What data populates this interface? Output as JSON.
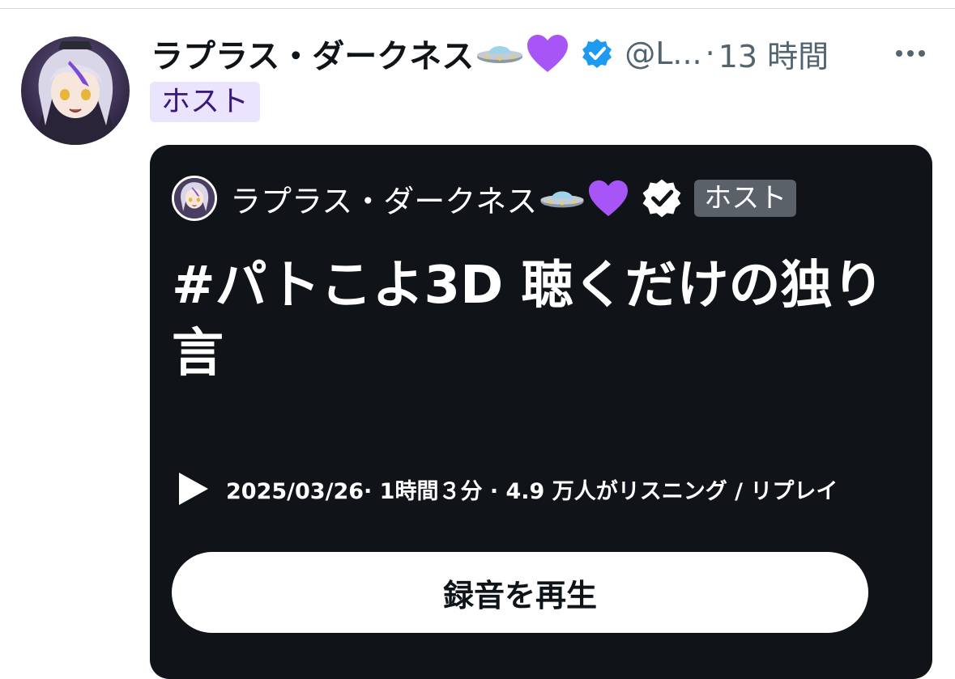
{
  "post": {
    "author_display_name": "ラプラス・ダークネス",
    "handle": "@L...",
    "separator": "·",
    "time_ago": "13 時間",
    "role_badge": "ホスト",
    "icons": {
      "avatar": "avatar-image",
      "ufo": "ufo-emoji-icon",
      "heart": "purple-heart-emoji-icon",
      "verified": "verified-badge-icon",
      "more": "more-options-icon"
    },
    "colors": {
      "verified_blue": "#1d9bf0",
      "badge_bg": "#ebe4ff",
      "card_bg": "#101418"
    }
  },
  "space_card": {
    "host_name": "ラプラス・ダークネス",
    "host_badge": "ホスト",
    "title": "#パトこよ3D 聴くだけの独り言",
    "meta": "2025/03/26· 1時間３分 · 4.9 万人がリスニング / リプレイ",
    "play_button_label": "録音を再生"
  }
}
